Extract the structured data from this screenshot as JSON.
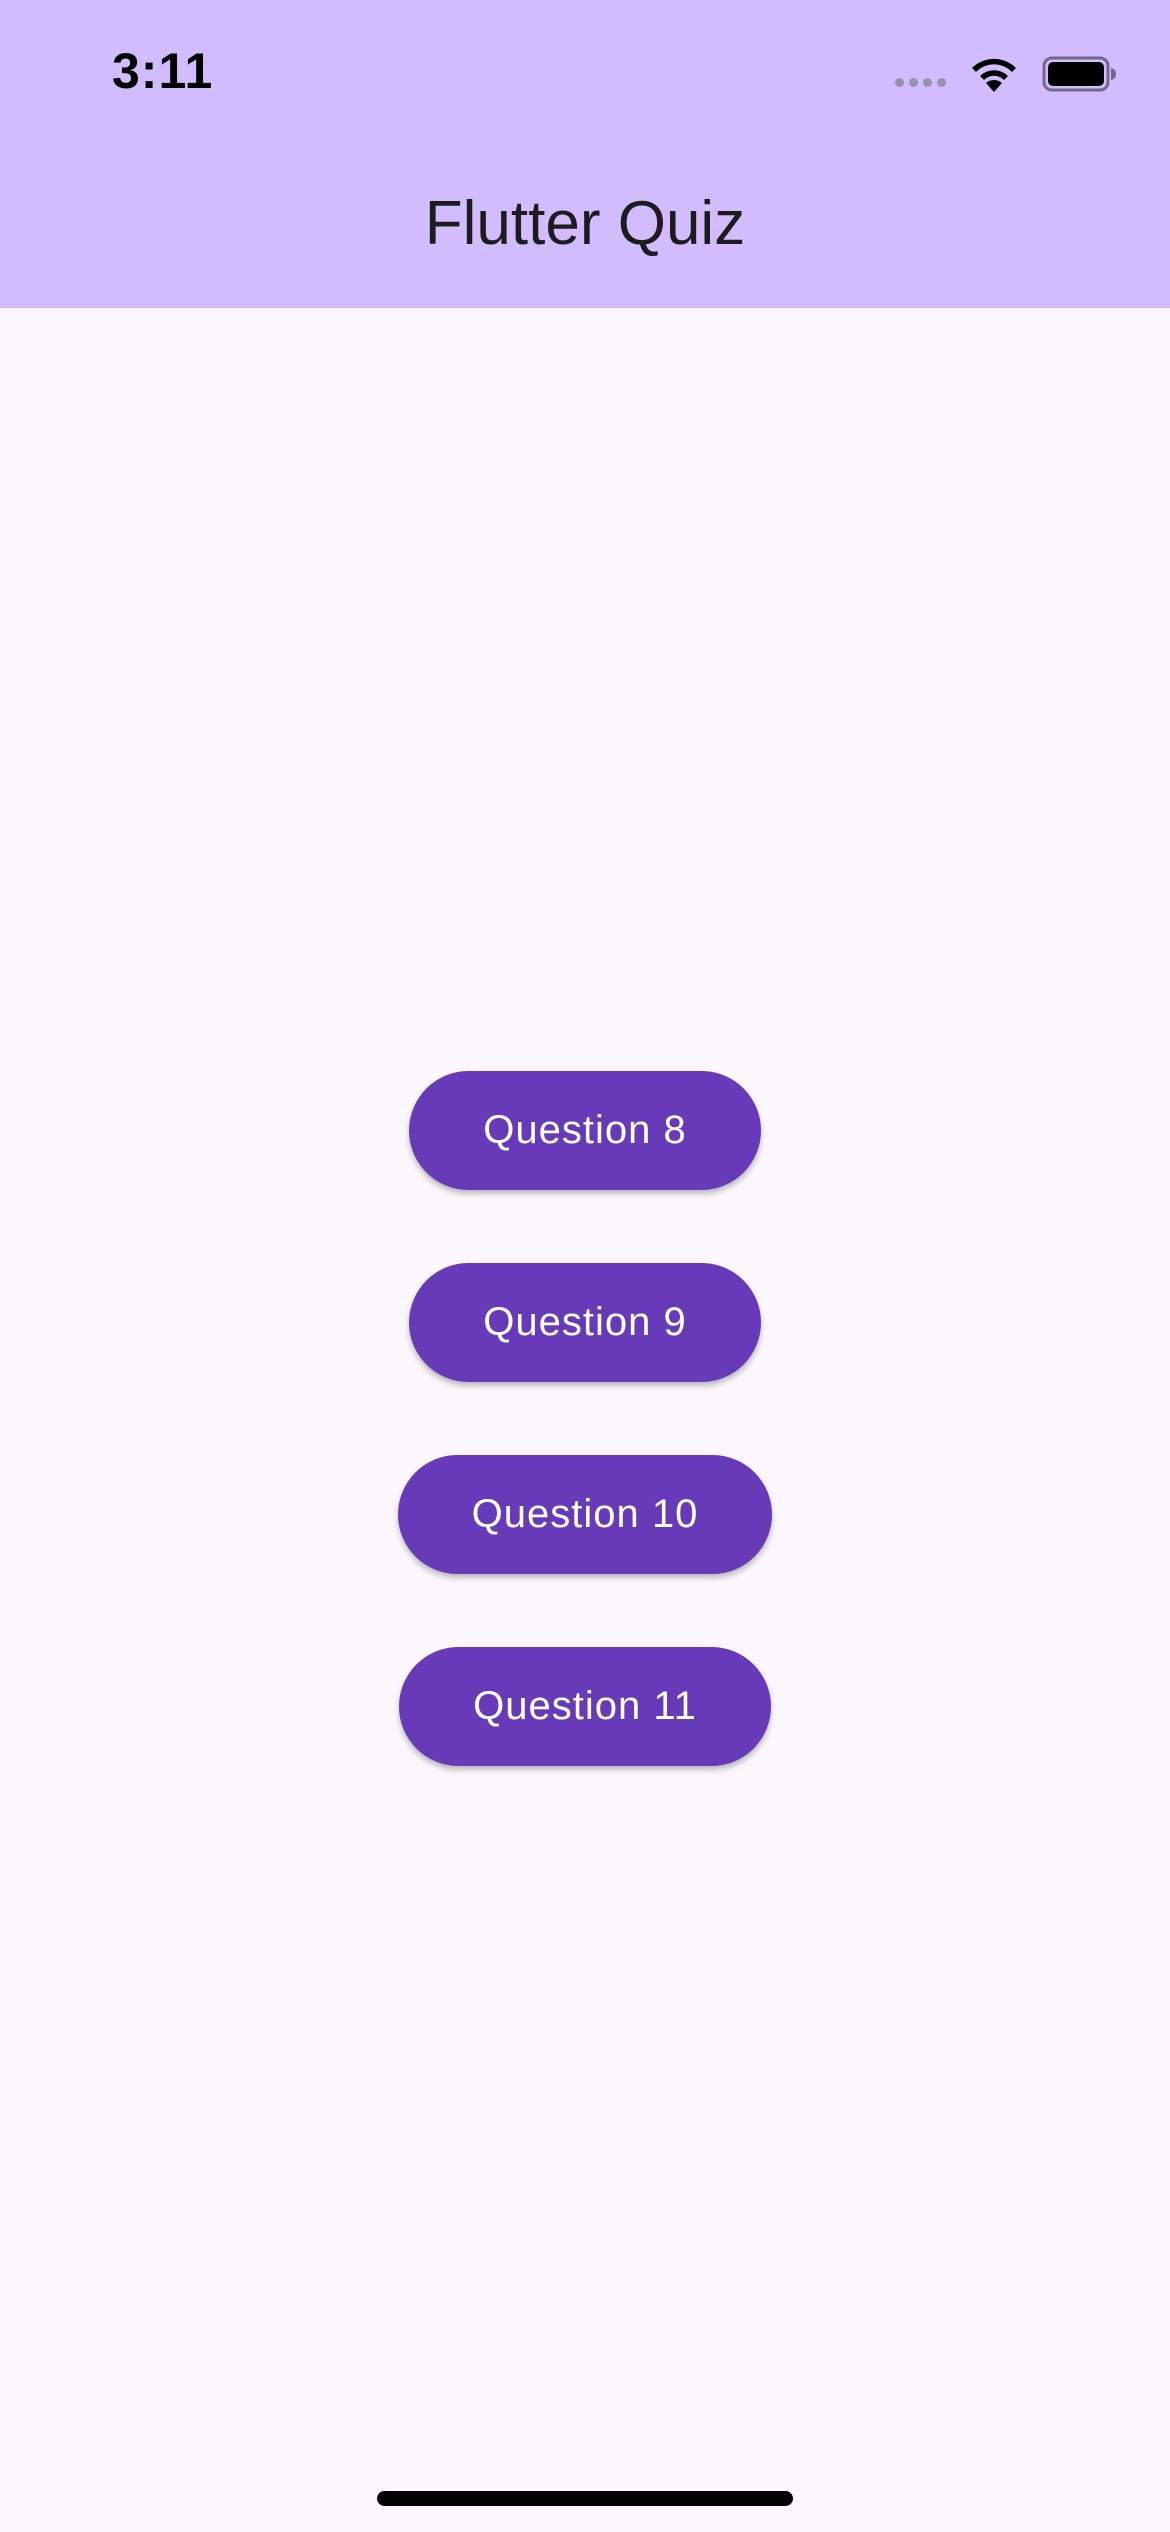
{
  "status_bar": {
    "time": "3:11",
    "icons": [
      "signal-icon",
      "wifi-icon",
      "battery-icon"
    ]
  },
  "app_bar": {
    "title": "Flutter Quiz",
    "background": "#D3BCFD"
  },
  "questions": [
    {
      "label": "Question 8"
    },
    {
      "label": "Question 9"
    },
    {
      "label": "Question 10"
    },
    {
      "label": "Question 11"
    }
  ],
  "colors": {
    "button": "#673AB7",
    "button_text": "#FFFFFF",
    "page_background": "#FCF7FD"
  }
}
